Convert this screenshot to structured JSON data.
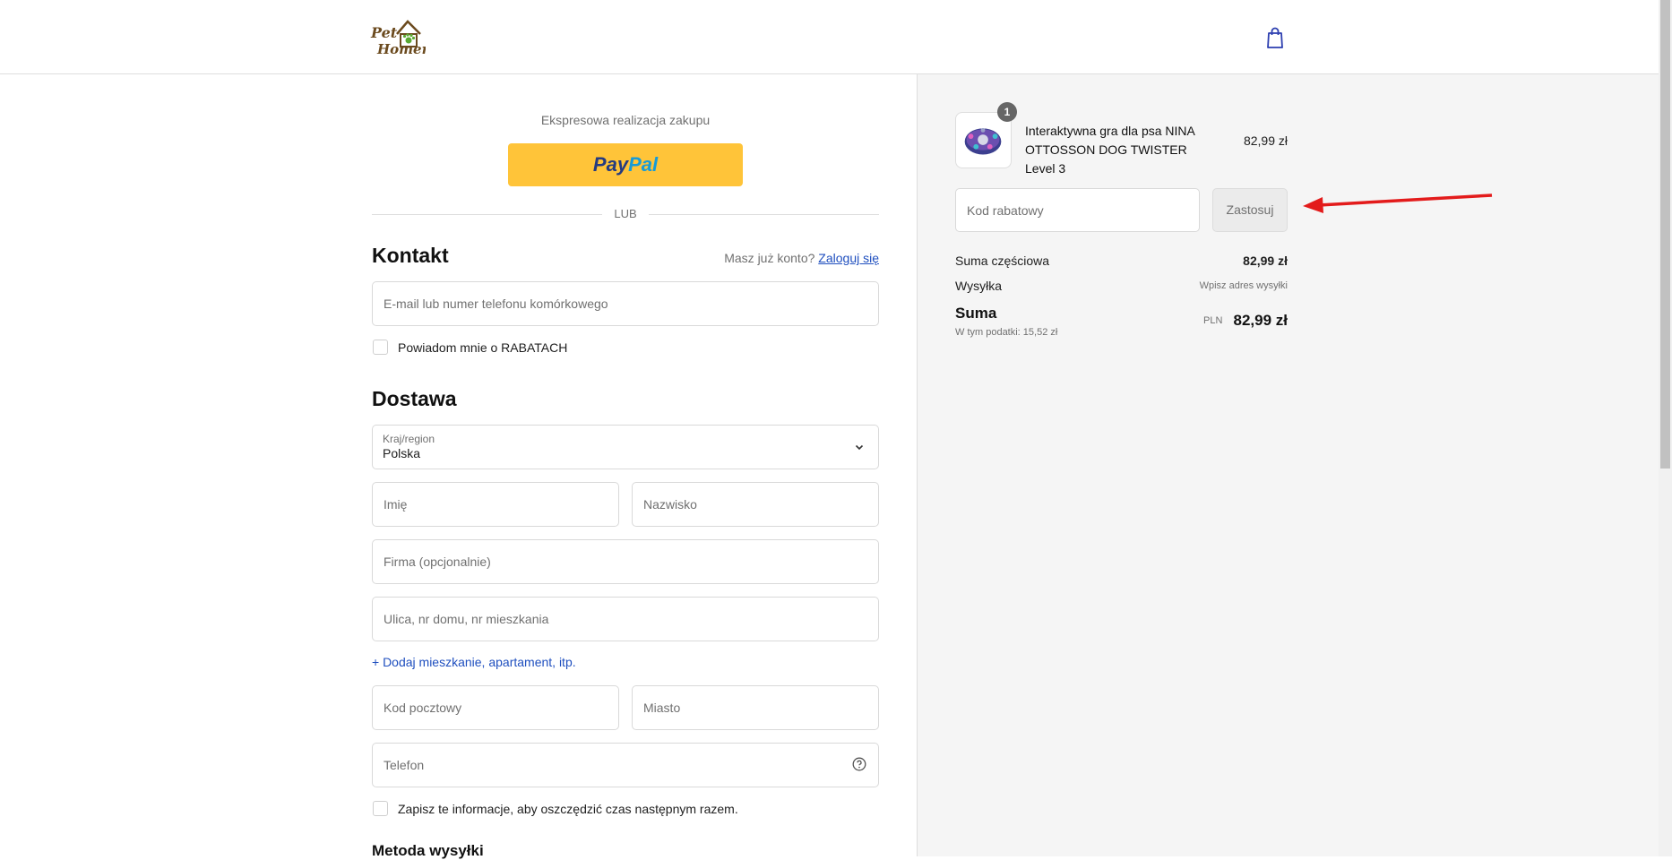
{
  "header": {
    "logo_text": "Pet Homer",
    "cart_icon": "shopping-bag-icon"
  },
  "express": {
    "label": "Ekspresowa realizacja zakupu",
    "paypal_part1": "Pay",
    "paypal_part2": "Pal",
    "divider": "LUB"
  },
  "contact": {
    "title": "Kontakt",
    "has_account": "Masz już konto?",
    "login_link": "Zaloguj się",
    "email_placeholder": "E-mail lub numer telefonu komórkowego",
    "newsletter_label": "Powiadom mnie o RABATACH"
  },
  "delivery": {
    "title": "Dostawa",
    "country_label": "Kraj/region",
    "country_value": "Polska",
    "first_name_placeholder": "Imię",
    "last_name_placeholder": "Nazwisko",
    "company_placeholder": "Firma (opcjonalnie)",
    "street_placeholder": "Ulica, nr domu, nr mieszkania",
    "add_apartment": "+ Dodaj mieszkanie, apartament, itp.",
    "postal_placeholder": "Kod pocztowy",
    "city_placeholder": "Miasto",
    "phone_placeholder": "Telefon",
    "save_info_label": "Zapisz te informacje, aby oszczędzić czas następnym razem.",
    "shipping_method_title": "Metoda wysyłki"
  },
  "summary": {
    "product": {
      "name": "Interaktywna gra dla psa NINA OTTOSSON DOG TWISTER Level 3",
      "price": "82,99 zł",
      "quantity": "1"
    },
    "discount_placeholder": "Kod rabatowy",
    "apply_label": "Zastosuj",
    "subtotal_label": "Suma częściowa",
    "subtotal_value": "82,99 zł",
    "shipping_label": "Wysyłka",
    "shipping_value": "Wpisz adres wysyłki",
    "total_label": "Suma",
    "tax_note": "W tym podatki: 15,52 zł",
    "currency": "PLN",
    "total_value": "82,99 zł"
  },
  "colors": {
    "paypal_yellow": "#ffc439",
    "link_blue": "#1f4fbf",
    "annotation_red": "#e31b1b",
    "panel_bg": "#f5f5f5"
  }
}
